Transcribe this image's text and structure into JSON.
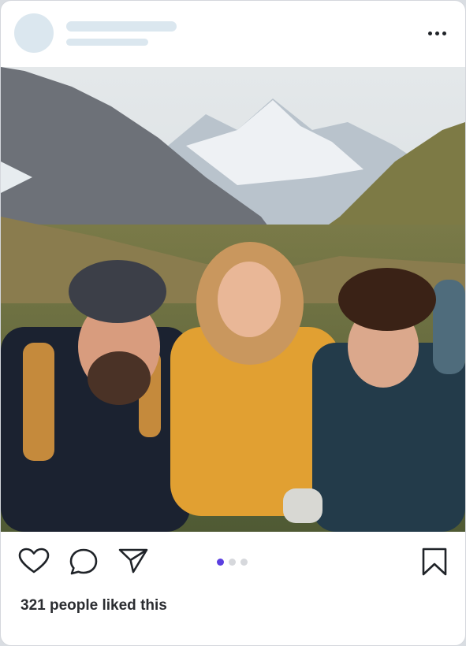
{
  "post": {
    "likes_text": "321 people liked this",
    "carousel_total": 3,
    "carousel_active": 1
  },
  "icons": {
    "more": "more-horizontal-icon",
    "like": "heart-icon",
    "comment": "comment-bubble-icon",
    "share": "send-icon",
    "save": "bookmark-icon"
  },
  "colors": {
    "accent": "#5b3fe0",
    "skeleton": "#dbe7ef",
    "icon": "#1f2328"
  }
}
